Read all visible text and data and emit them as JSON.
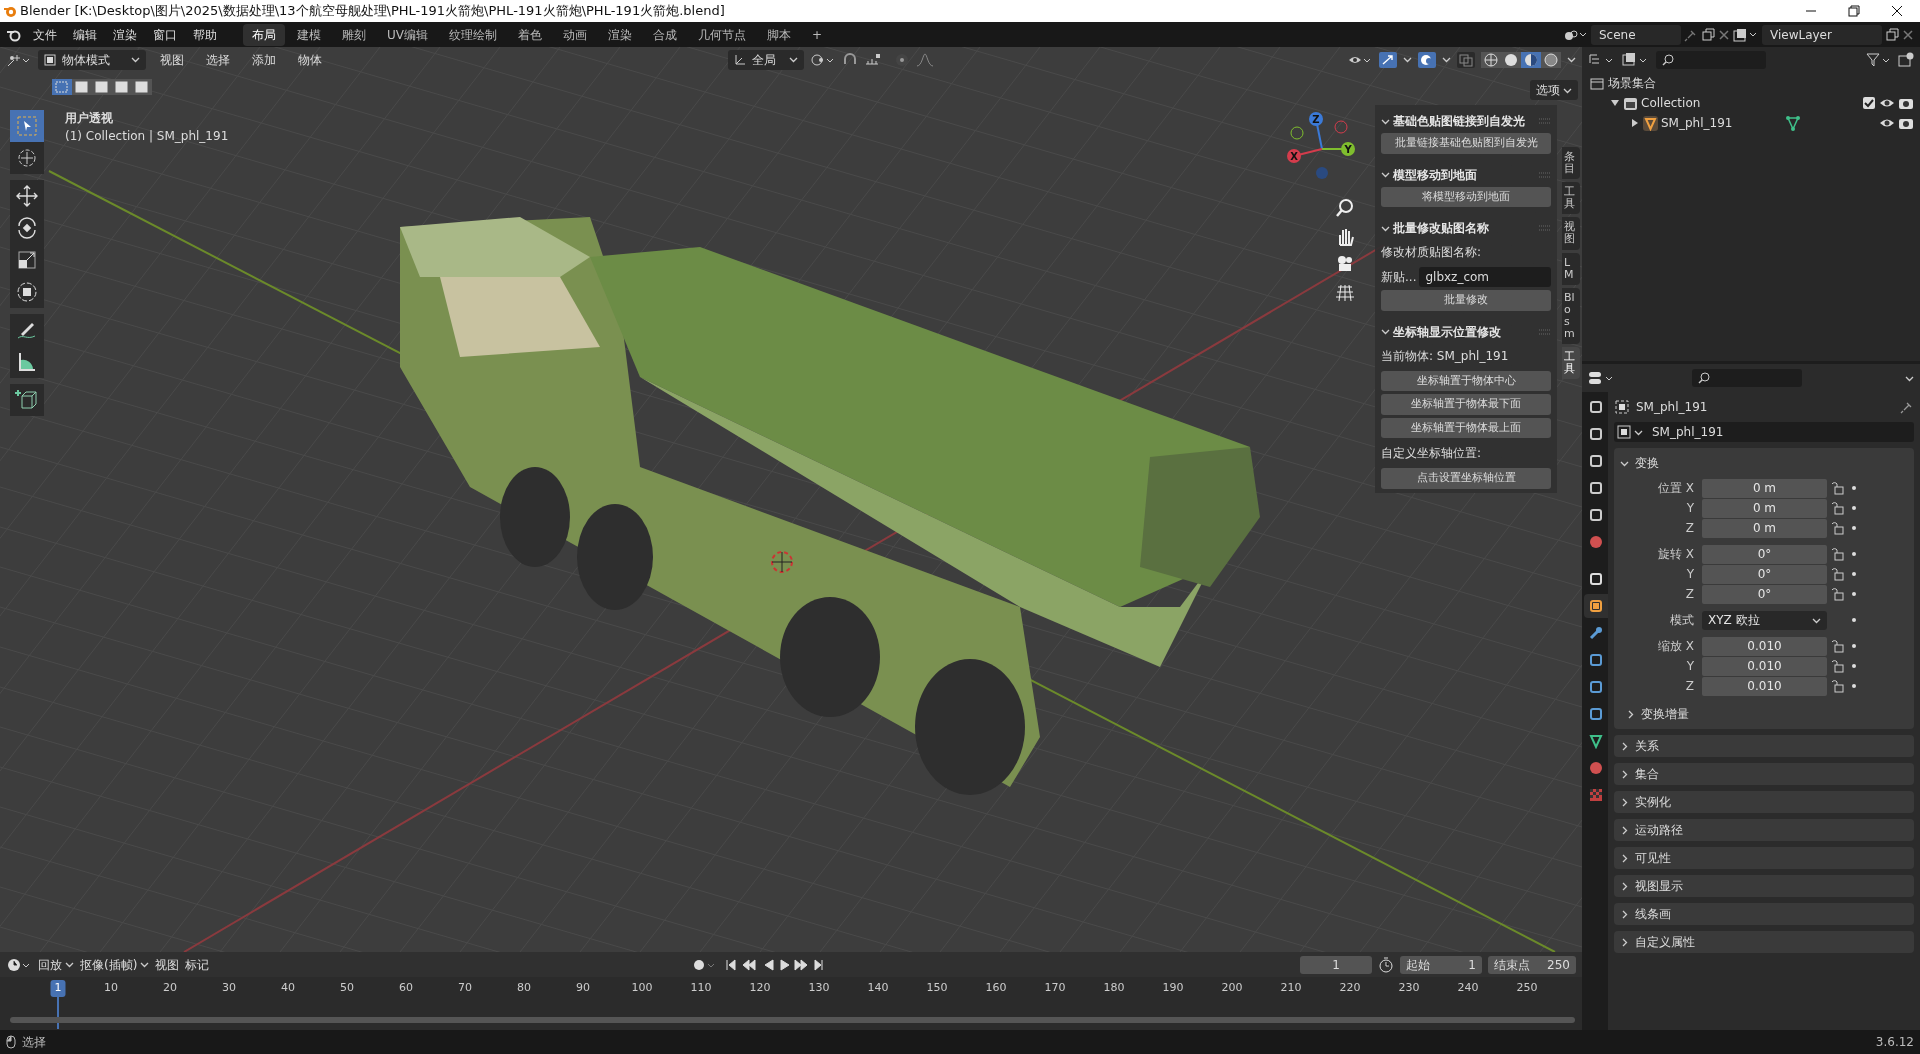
{
  "window": {
    "title": "Blender [K:\\Desktop\\图片\\2025\\数据处理\\13个航空母舰处理\\PHL-191火箭炮\\PHL-191火箭炮\\PHL-191火箭炮.blend]"
  },
  "menu": [
    "文件",
    "编辑",
    "渲染",
    "窗口",
    "帮助"
  ],
  "workspaces": [
    {
      "label": "布局",
      "selected": true
    },
    {
      "label": "建模",
      "selected": false
    },
    {
      "label": "雕刻",
      "selected": false
    },
    {
      "label": "UV编辑",
      "selected": false
    },
    {
      "label": "纹理绘制",
      "selected": false
    },
    {
      "label": "着色",
      "selected": false
    },
    {
      "label": "动画",
      "selected": false
    },
    {
      "label": "渲染",
      "selected": false
    },
    {
      "label": "合成",
      "selected": false
    },
    {
      "label": "几何节点",
      "selected": false
    },
    {
      "label": "脚本",
      "selected": false
    }
  ],
  "add_workspace": "+",
  "scene": "Scene",
  "view_layer": "ViewLayer",
  "viewport": {
    "mode": "物体模式",
    "menus": [
      "视图",
      "选择",
      "添加",
      "物体"
    ],
    "orientation": "全局",
    "options": "选项",
    "toggles": [
      {
        "kind": "gizmo",
        "on": true
      },
      {
        "kind": "overlay",
        "on": true
      },
      {
        "kind": "xray",
        "on": false
      }
    ],
    "shading": [
      {
        "kind": "wireframe",
        "selected": false
      },
      {
        "kind": "solid",
        "selected": false
      },
      {
        "kind": "material",
        "selected": true
      },
      {
        "kind": "rendered",
        "selected": false
      }
    ],
    "select_modes": [
      {
        "selected": true
      },
      {
        "selected": false
      },
      {
        "selected": false
      },
      {
        "selected": false
      },
      {
        "selected": false
      }
    ],
    "view_name": "用户透视",
    "collection_info": "(1) Collection | SM_phl_191",
    "tools": [
      {
        "kind": "select",
        "selected": true
      },
      {
        "kind": "cursor",
        "selected": false
      },
      {
        "kind": "move",
        "selected": false
      },
      {
        "kind": "rotate",
        "selected": false
      },
      {
        "kind": "scale",
        "selected": false
      },
      {
        "kind": "transform",
        "selected": false
      },
      {
        "kind": "annotate",
        "selected": false
      },
      {
        "kind": "measure",
        "selected": false
      },
      {
        "kind": "add-cube",
        "selected": false
      }
    ],
    "gizmo_axes": [
      "Z",
      "Y",
      "X"
    ]
  },
  "sidebar": {
    "tabs": [
      {
        "label": "条目",
        "selected": false
      },
      {
        "label": "工具",
        "selected": false
      },
      {
        "label": "视图",
        "selected": false
      },
      {
        "label": "LM",
        "selected": false
      },
      {
        "label": "Blosm",
        "selected": false
      },
      {
        "label": "工具",
        "selected": true
      }
    ],
    "panels": [
      {
        "title": "基础色贴图链接到自发光",
        "items": [
          {
            "kind": "button",
            "text": "批量链接基础色贴图到自发光"
          }
        ]
      },
      {
        "title": "模型移动到地面",
        "items": [
          {
            "kind": "button",
            "text": "将模型移动到地面"
          }
        ]
      },
      {
        "title": "批量修改贴图名称",
        "items": [
          {
            "kind": "label",
            "text": "修改材质贴图名称:"
          },
          {
            "kind": "field",
            "text": "新贴...",
            "value": "glbxz_com"
          },
          {
            "kind": "button",
            "text": "批量修改"
          }
        ]
      },
      {
        "title": "坐标轴显示位置修改",
        "items": [
          {
            "kind": "label",
            "text": "当前物体: SM_phl_191"
          },
          {
            "kind": "button",
            "text": "坐标轴置于物体中心"
          },
          {
            "kind": "button",
            "text": "坐标轴置于物体最下面"
          },
          {
            "kind": "button",
            "text": "坐标轴置于物体最上面"
          },
          {
            "kind": "label",
            "text": "自定义坐标轴位置:"
          },
          {
            "kind": "button",
            "text": "点击设置坐标轴位置"
          }
        ]
      }
    ]
  },
  "outliner": {
    "items": [
      {
        "label": "场景集合",
        "kind": "scene",
        "children": [
          {
            "label": "Collection",
            "kind": "collection",
            "expanded": true,
            "checked": true,
            "children": [
              {
                "label": "SM_phl_191",
                "kind": "mesh",
                "expanded": false
              }
            ]
          }
        ]
      }
    ]
  },
  "properties": {
    "tabs": [
      {
        "kind": "tool",
        "selected": false
      },
      {
        "kind": "render",
        "selected": false
      },
      {
        "kind": "output",
        "selected": false
      },
      {
        "kind": "view-layer",
        "selected": false
      },
      {
        "kind": "scene",
        "selected": false
      },
      {
        "kind": "world",
        "selected": false
      },
      {
        "kind": "collection",
        "selected": false
      },
      {
        "kind": "object",
        "selected": true
      },
      {
        "kind": "modifier",
        "selected": false
      },
      {
        "kind": "particles",
        "selected": false
      },
      {
        "kind": "physics",
        "selected": false
      },
      {
        "kind": "constraint",
        "selected": false
      },
      {
        "kind": "data",
        "selected": false
      },
      {
        "kind": "material",
        "selected": false
      },
      {
        "kind": "texture",
        "selected": false
      }
    ],
    "object_name": "SM_phl_191",
    "datablock": "SM_phl_191",
    "transform": {
      "title": "变换",
      "expanded": true,
      "groups": [
        [
          {
            "label": "位置 X",
            "value": "0 m"
          },
          {
            "label": "Y",
            "value": "0 m"
          },
          {
            "label": "Z",
            "value": "0 m"
          }
        ],
        [
          {
            "label": "旋转 X",
            "value": "0°"
          },
          {
            "label": "Y",
            "value": "0°"
          },
          {
            "label": "Z",
            "value": "0°"
          }
        ],
        [
          {
            "label": "模式",
            "value": "XYZ 欧拉",
            "kind": "dropdown"
          }
        ],
        [
          {
            "label": "缩放 X",
            "value": "0.010"
          },
          {
            "label": "Y",
            "value": "0.010"
          },
          {
            "label": "Z",
            "value": "0.010"
          }
        ]
      ],
      "subpanel": "变换增量"
    },
    "panels": [
      "关系",
      "集合",
      "实例化",
      "运动路径",
      "可见性",
      "视图显示",
      "线条画",
      "自定义属性"
    ]
  },
  "timeline": {
    "menus": [
      "回放",
      "抠像(插帧)",
      "视图",
      "标记"
    ],
    "current_frame": "1",
    "start_label": "起始",
    "start": "1",
    "end_label": "结束点",
    "end": "250",
    "playhead": "1",
    "ticks": [
      "10",
      "20",
      "30",
      "40",
      "50",
      "60",
      "70",
      "80",
      "90",
      "100",
      "110",
      "120",
      "130",
      "140",
      "150",
      "160",
      "170",
      "180",
      "190",
      "200",
      "210",
      "220",
      "230",
      "240",
      "250"
    ]
  },
  "status_bar": {
    "hint": "选择",
    "version": "3.6.12"
  }
}
